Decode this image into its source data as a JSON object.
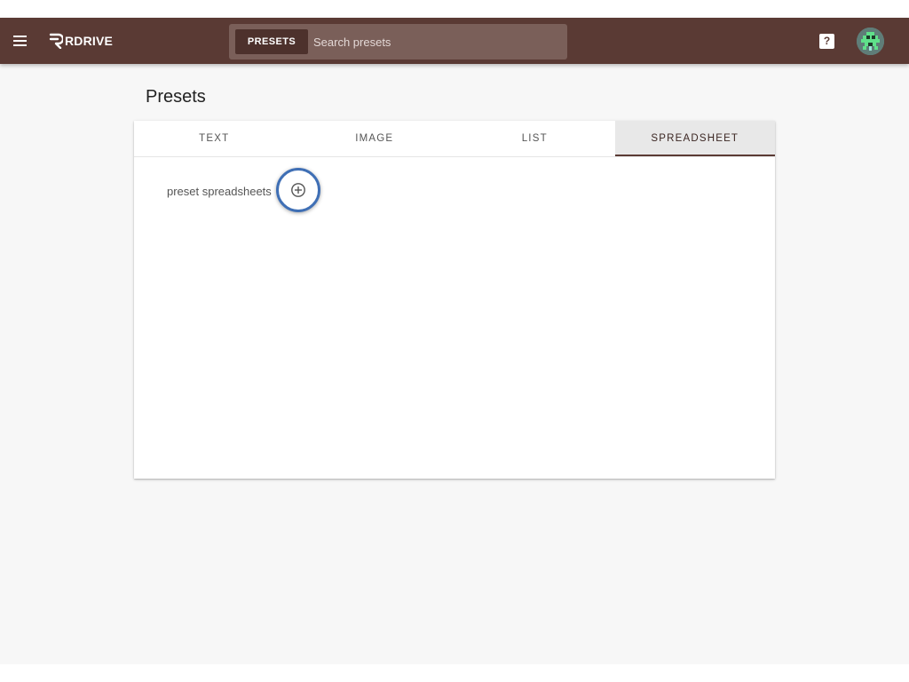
{
  "app": {
    "brand": "RDRIVE"
  },
  "search": {
    "chip_label": "PRESETS",
    "placeholder": "Search presets"
  },
  "header": {
    "help_label": "?"
  },
  "page": {
    "title": "Presets"
  },
  "tabs": [
    {
      "label": "TEXT",
      "active": false
    },
    {
      "label": "IMAGE",
      "active": false
    },
    {
      "label": "LIST",
      "active": false
    },
    {
      "label": "SPREADSHEET",
      "active": true
    }
  ],
  "content": {
    "label": "preset spreadsheets"
  },
  "icons": {
    "menu": "menu-icon",
    "logo": "rdrive-logo-icon",
    "help": "help-icon",
    "avatar": "pixel-avatar-icon",
    "add": "add-circle-icon"
  },
  "colors": {
    "appbar": "#5a3a34",
    "search_bg": "#7a5f59",
    "chip_bg": "#4d312c",
    "active_tab_bg": "#e8e8e8",
    "highlight_ring": "#3f6fb5",
    "page_bg": "#f7f7f7"
  }
}
